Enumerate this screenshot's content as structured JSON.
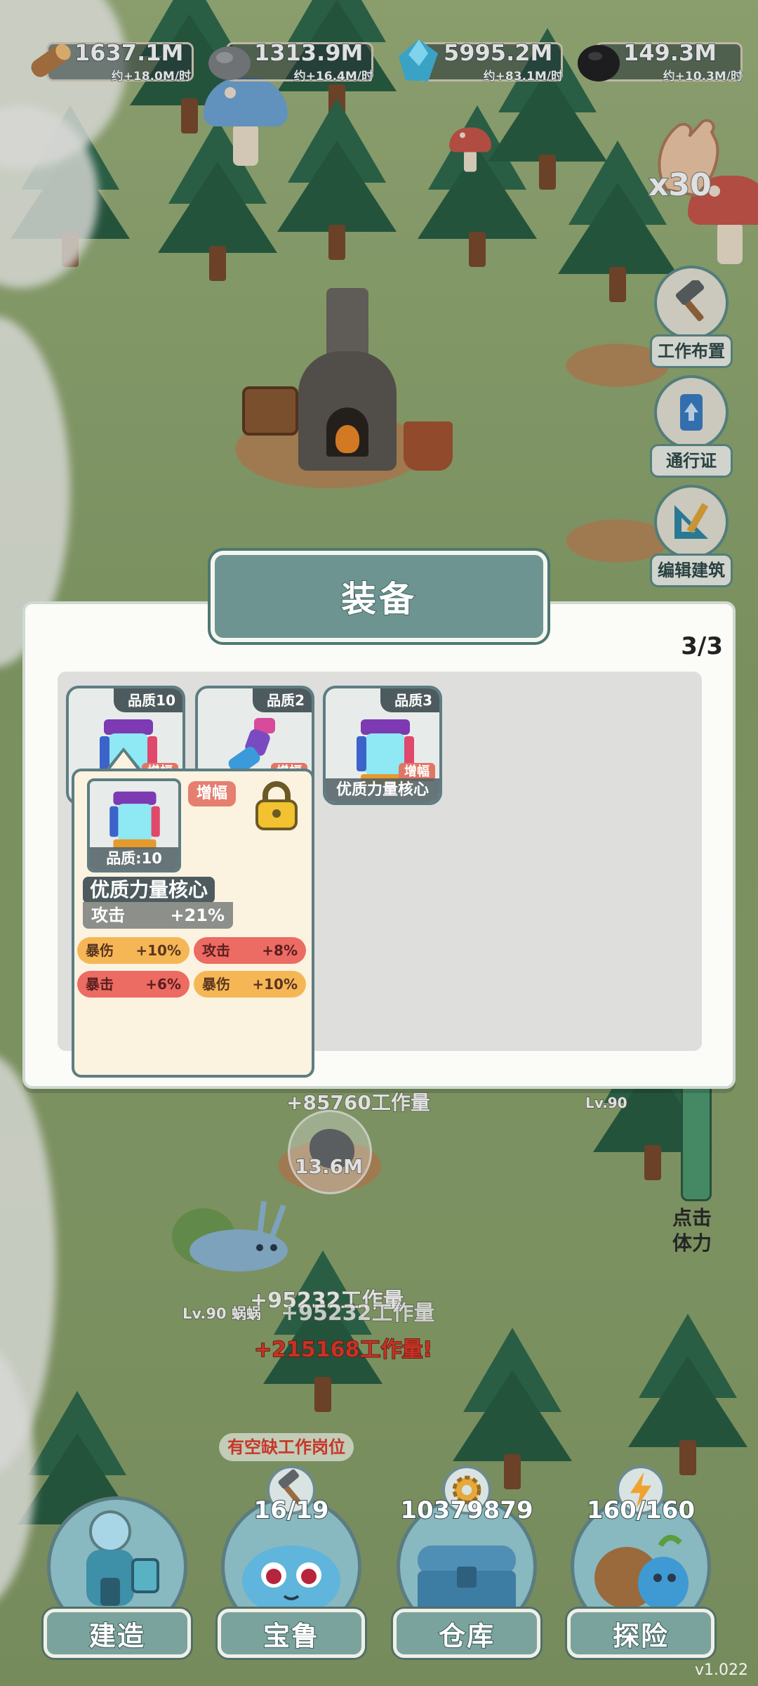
{
  "resources": [
    {
      "icon": "wood-log-icon",
      "amount": "1637.1M",
      "rate": "约+18.0M/时"
    },
    {
      "icon": "stone-icon",
      "amount": "1313.9M",
      "rate": "约+16.4M/时"
    },
    {
      "icon": "crystal-icon",
      "amount": "5995.2M",
      "rate": "约+83.1M/时"
    },
    {
      "icon": "coal-icon",
      "amount": "149.3M",
      "rate": "约+10.3M/时"
    }
  ],
  "tap_boost": {
    "label": "x30"
  },
  "side_tools": [
    {
      "icon": "hammer-icon",
      "label": "工作布置"
    },
    {
      "icon": "ticket-icon",
      "label": "通行证"
    },
    {
      "icon": "ruler-triangle-icon",
      "label": "编辑建筑"
    }
  ],
  "modal": {
    "title": "装备",
    "slot_count": "3/3",
    "items": [
      {
        "quality": "品质10",
        "tag": "增幅",
        "icon": "power-core-icon"
      },
      {
        "quality": "品质2",
        "tag": "增幅",
        "icon": "mech-arm-icon"
      },
      {
        "quality": "品质3",
        "tag": "增幅",
        "name": "优质力量核心",
        "icon": "power-core-icon"
      }
    ],
    "detail": {
      "quality_label": "品质:10",
      "badge": "增幅",
      "name": "优质力量核心",
      "main_stat": {
        "name": "攻击",
        "value": "+21%"
      },
      "sub_stats": [
        {
          "name": "暴伤",
          "value": "+10%",
          "color": "#f5b755"
        },
        {
          "name": "攻击",
          "value": "+8%",
          "color": "#ec6b62"
        },
        {
          "name": "暴击",
          "value": "+6%",
          "color": "#ec6b62"
        },
        {
          "name": "暴伤",
          "value": "+10%",
          "color": "#f5b755"
        }
      ],
      "lock_icon": "padlock-icon"
    }
  },
  "world": {
    "work_gain_top": "+85760工作量",
    "rock_amount": "13.6M",
    "work_gain_mid": "+95232工作量",
    "work_gain_mid2": "+95232工作量",
    "snail_label": "Lv.90 蜗蜗",
    "work_gain_crit": "+215168工作量!",
    "level_label_right": "Lv.90",
    "stamina_label_1": "点击",
    "stamina_label_2": "体力",
    "vacancy": "有空缺工作岗位"
  },
  "nav": [
    {
      "label": "建造",
      "count": "",
      "icon": "build-house-icon"
    },
    {
      "label": "宝鲁",
      "count": "16/19",
      "icon": "creature-icon",
      "top_icon": "hammer-icon"
    },
    {
      "label": "仓库",
      "count": "10379879",
      "icon": "chest-icon",
      "top_icon": "gear-icon"
    },
    {
      "label": "探险",
      "count": "160/160",
      "icon": "explore-icon",
      "top_icon": "lightning-icon"
    }
  ],
  "version": "v1.022"
}
